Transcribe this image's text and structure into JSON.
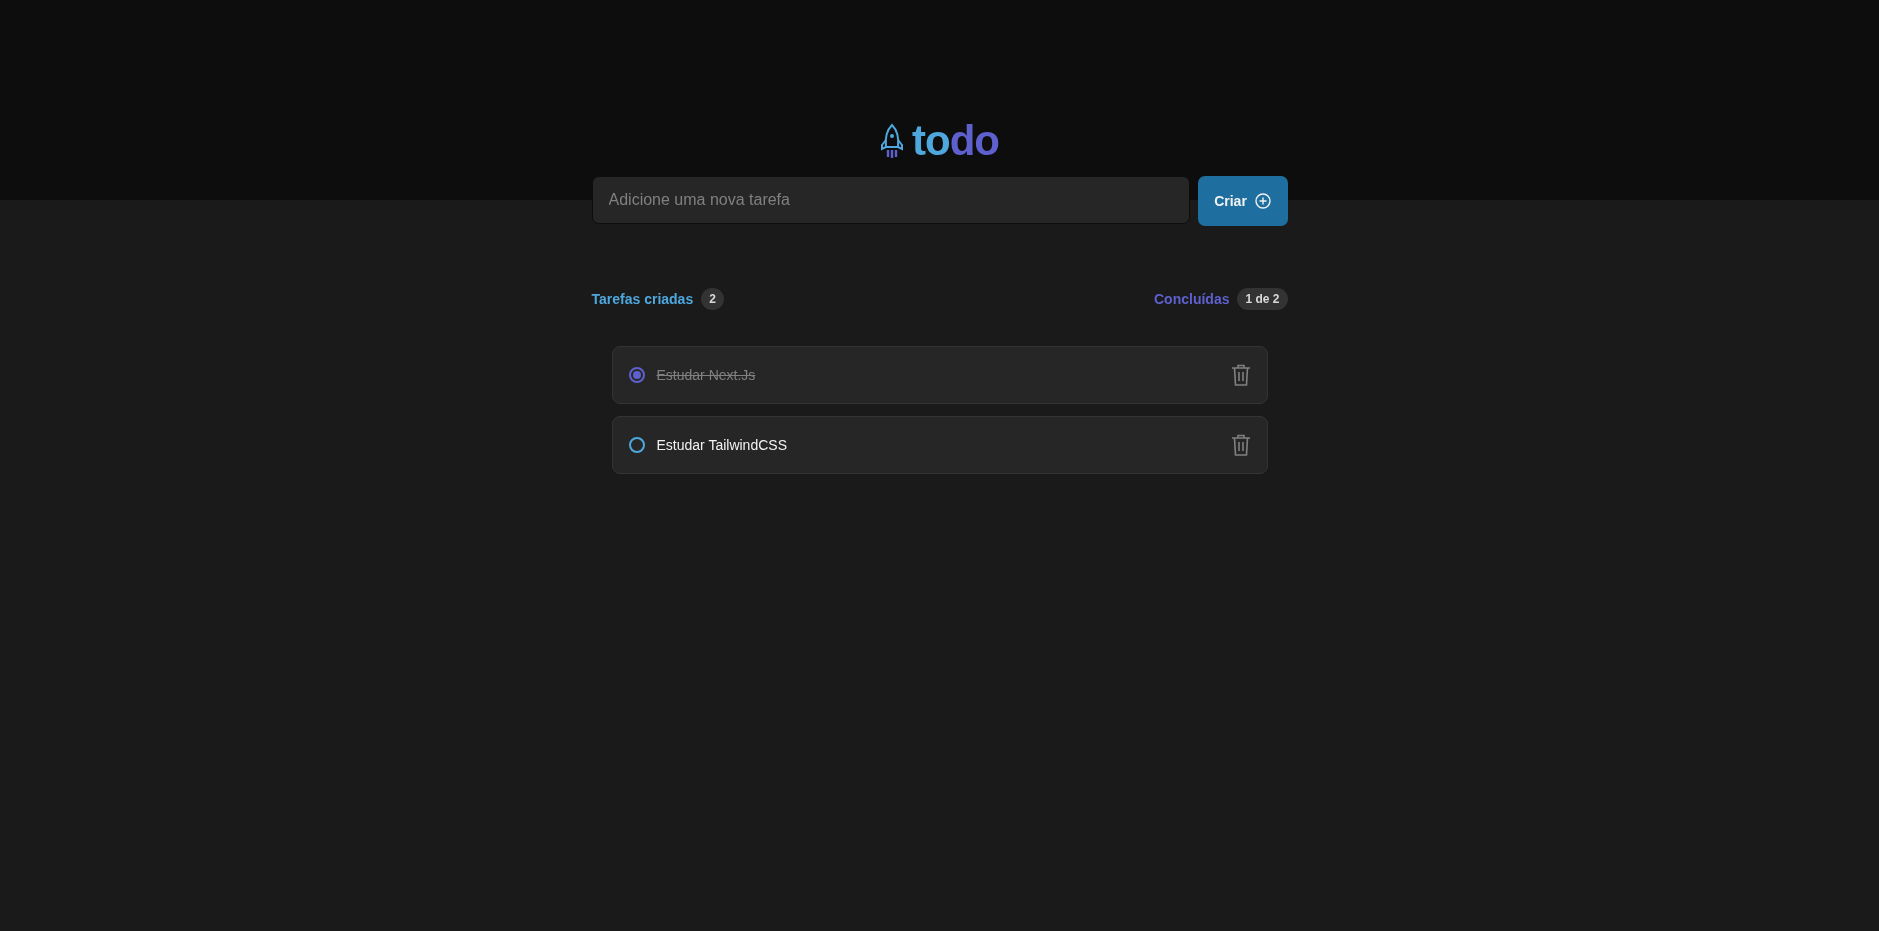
{
  "logo": {
    "first": "to",
    "second": "do"
  },
  "new_task": {
    "placeholder": "Adicione uma nova tarefa",
    "button": "Criar"
  },
  "counters": {
    "created_label": "Tarefas criadas",
    "created_count": "2",
    "done_label": "Concluídas",
    "done_count": "1 de 2"
  },
  "tasks": [
    {
      "text": "Estudar Next.Js",
      "checked": true
    },
    {
      "text": "Estudar TailwindCSS",
      "checked": false
    }
  ]
}
